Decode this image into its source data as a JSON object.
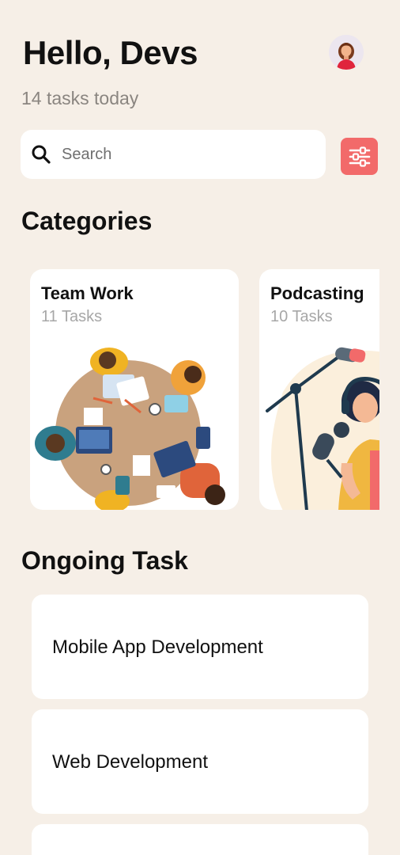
{
  "header": {
    "greeting": "Hello, Devs",
    "subtitle": "14 tasks today",
    "avatar_icon": "user-avatar-icon"
  },
  "search": {
    "placeholder": "Search",
    "value": "",
    "icon": "search-icon"
  },
  "filter": {
    "icon": "sliders-icon",
    "color": "#f26a6a"
  },
  "categories": {
    "title": "Categories",
    "items": [
      {
        "title": "Team Work",
        "subtitle": "11 Tasks",
        "illustration": "team-work-illustration"
      },
      {
        "title": "Podcasting",
        "subtitle": "10 Tasks",
        "illustration": "podcasting-illustration"
      }
    ]
  },
  "ongoing": {
    "title": "Ongoing Task",
    "items": [
      {
        "label": "Mobile App Development"
      },
      {
        "label": "Web Development"
      },
      {
        "label": ""
      }
    ]
  },
  "colors": {
    "background": "#f6efe7",
    "card": "#ffffff",
    "accent": "#f26a6a",
    "muted_text": "#8a8580"
  }
}
